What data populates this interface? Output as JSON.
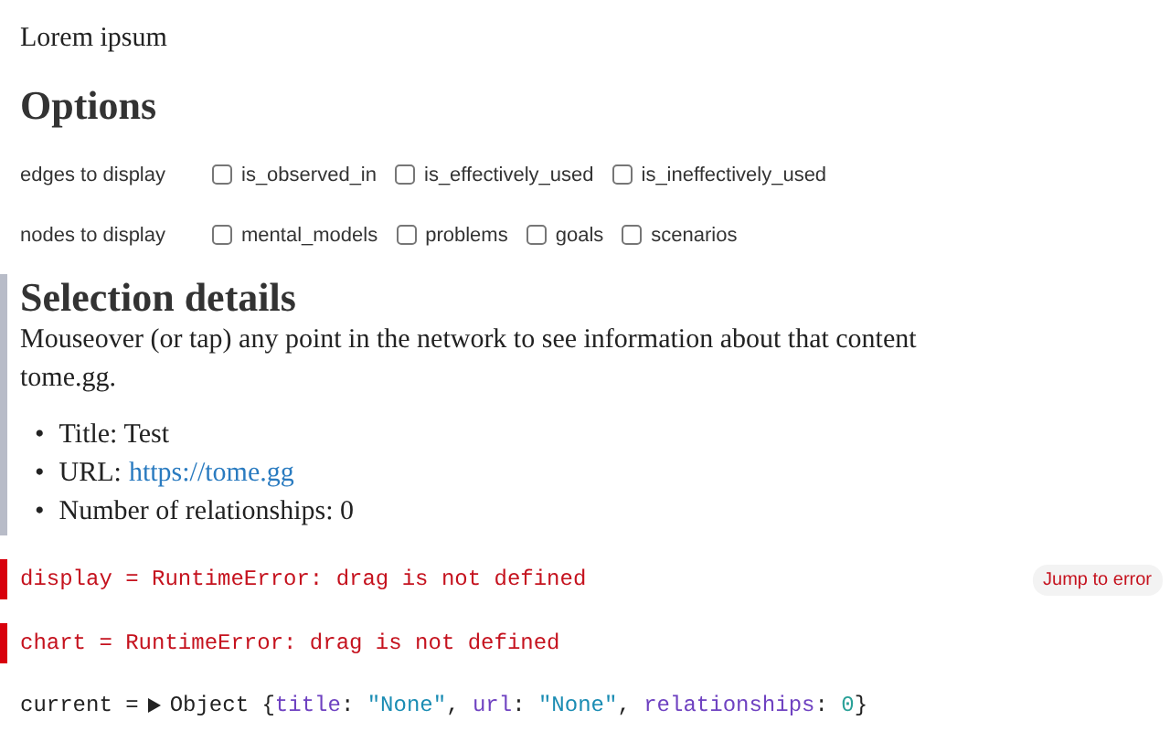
{
  "intro": "Lorem ipsum",
  "options": {
    "heading": "Options",
    "groups": [
      {
        "label": "edges to display",
        "items": [
          {
            "label": "is_observed_in",
            "checked": false
          },
          {
            "label": "is_effectively_used",
            "checked": false
          },
          {
            "label": "is_ineffectively_used",
            "checked": false
          }
        ]
      },
      {
        "label": "nodes to display",
        "items": [
          {
            "label": "mental_models",
            "checked": false
          },
          {
            "label": "problems",
            "checked": false
          },
          {
            "label": "goals",
            "checked": false
          },
          {
            "label": "scenarios",
            "checked": false
          }
        ]
      }
    ]
  },
  "selection": {
    "heading": "Selection details",
    "description": "Mouseover (or tap) any point in the network to see information about that content tome.gg.",
    "items": [
      {
        "kind": "text",
        "marker": "•",
        "text": "Title: Test"
      },
      {
        "kind": "link",
        "marker": "•",
        "label": "URL:",
        "link": "https://tome.gg"
      },
      {
        "kind": "text",
        "marker": "•",
        "text": "Number of relationships: 0"
      }
    ]
  },
  "cells": [
    {
      "kind": "error",
      "text": "display = RuntimeError: drag is not defined",
      "button": "Jump to error"
    },
    {
      "kind": "error",
      "text": "chart = RuntimeError: drag is not defined"
    },
    {
      "kind": "object",
      "name": "current =",
      "tokens": [
        {
          "kind": "plain",
          "text": "Object {"
        },
        {
          "kind": "key",
          "text": "title"
        },
        {
          "kind": "plain",
          "text": ": "
        },
        {
          "kind": "string",
          "text": "\"None\""
        },
        {
          "kind": "plain",
          "text": ", "
        },
        {
          "kind": "key",
          "text": "url"
        },
        {
          "kind": "plain",
          "text": ": "
        },
        {
          "kind": "string",
          "text": "\"None\""
        },
        {
          "kind": "plain",
          "text": ", "
        },
        {
          "kind": "key",
          "text": "relationships"
        },
        {
          "kind": "plain",
          "text": ": "
        },
        {
          "kind": "number",
          "text": "0"
        },
        {
          "kind": "plain",
          "text": "}"
        }
      ]
    }
  ]
}
